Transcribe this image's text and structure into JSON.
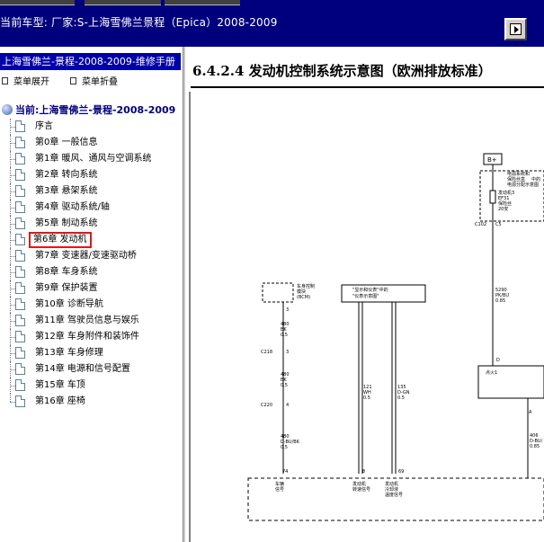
{
  "header": {
    "vehicle_line": "当前车型:  厂家:S-上海雪佛兰景程（Epica）2008-2009"
  },
  "sidebar": {
    "manual_title": "上海雪佛兰-景程-2008-2009-维修手册",
    "expand_label": "菜单展开",
    "collapse_label": "菜单折叠",
    "root_label": "当前:上海雪佛兰-景程-2008-2009",
    "items": [
      {
        "label": "序言"
      },
      {
        "label": "第0章 一般信息"
      },
      {
        "label": "第1章 暖风、通风与空调系统"
      },
      {
        "label": "第2章 转向系统"
      },
      {
        "label": "第3章 悬架系统"
      },
      {
        "label": "第4章 驱动系统/轴"
      },
      {
        "label": "第5章 制动系统"
      },
      {
        "label": "第6章 发动机",
        "selected": true
      },
      {
        "label": "第7章 变速器/变速驱动桥"
      },
      {
        "label": "第8章 车身系统"
      },
      {
        "label": "第9章 保护装置"
      },
      {
        "label": "第10章 诊断导航"
      },
      {
        "label": "第11章 驾驶员信息与娱乐"
      },
      {
        "label": "第12章 车身附件和装饰件"
      },
      {
        "label": "第13章 车身修理"
      },
      {
        "label": "第14章 电源和信号配置"
      },
      {
        "label": "第15章 车顶"
      },
      {
        "label": "第16章 座椅"
      }
    ]
  },
  "document": {
    "title": "6.4.2.4 发动机控制系统示意图（欧洲排放标准）"
  },
  "diagram": {
    "bplus": "B+",
    "fuse_block_1": "电源系统和",
    "fuse_block_2": "保险丝盒",
    "fuse_block_3": "中的",
    "fuse_block_4": "电源分配示意图",
    "fuse_name_1": "发动机3",
    "fuse_name_2": "EF31",
    "fuse_name_3": "保险丝",
    "fuse_name_4": "20安",
    "conn_c102": "C102",
    "conn_c5": "C5",
    "bcm_1": "车身控制",
    "bcm_2": "模块",
    "bcm_3": "(BCM)",
    "display_1": "\"显示和仪表\"中的",
    "display_2": "\"仪表示意图\"",
    "bcm_pin": "3",
    "w1_gauge": "480",
    "w1_color": "BK",
    "w1_size": "0.5",
    "conn_c218": "C218",
    "c218_pin": "3",
    "w2_gauge": "480",
    "w2_color": "BK",
    "w2_size": "0.5",
    "conn_c220": "C220",
    "c220_pin": "4",
    "w3_gauge": "480",
    "w3_color": "D-BU/BK",
    "w3_size": "0.5",
    "w4_gauge": "121",
    "w4_color": "WH",
    "w4_size": "0.5",
    "w5_gauge": "135",
    "w5_color": "D-GN",
    "w5_size": "0.5",
    "w6_gauge": "5290",
    "w6_color": "PK/BU",
    "w6_size": "0.85",
    "pin_d": "D",
    "ignition_label": "点火1",
    "pin_a": "A",
    "w7_gauge": "406",
    "w7_color": "D-BU/",
    "w7_size": "0.85",
    "pin_74": "74",
    "pin_8": "8",
    "pin_69": "69",
    "ecm_1a": "车辆",
    "ecm_1b": "信号",
    "ecm_2a": "发动机",
    "ecm_2b": "转速信号",
    "ecm_3a": "发动机",
    "ecm_3b": "冷却液",
    "ecm_3c": "温度信号"
  },
  "colors": {
    "header_bg": "#00007f",
    "title_bar_bg": "#0000aa",
    "selection_border": "#e01818"
  }
}
